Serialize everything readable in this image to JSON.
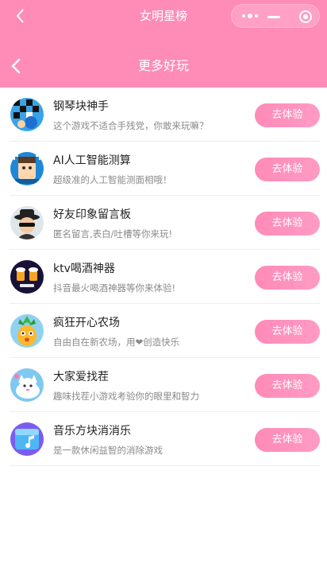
{
  "topbar": {
    "title": "女明星榜"
  },
  "page": {
    "title": "更多好玩"
  },
  "colors": {
    "primary": "#ff8bb7",
    "button": "#ff8ab8"
  },
  "games": [
    {
      "name": "钢琴块神手",
      "desc": "这个游戏不适合手残党，你敢来玩嘛？",
      "button": "去体验",
      "icon": "piano-tiles-icon"
    },
    {
      "name": "AI人工智能测算",
      "desc": "超级准的人工智能测面相哦！",
      "button": "去体验",
      "icon": "ai-face-icon"
    },
    {
      "name": "好友印象留言板",
      "desc": "匿名留言,表白/吐槽等你来玩!",
      "button": "去体验",
      "icon": "spy-icon"
    },
    {
      "name": "ktv喝酒神器",
      "desc": "抖音最火喝酒神器等你来体验!",
      "button": "去体验",
      "icon": "beer-icon"
    },
    {
      "name": "疯狂开心农场",
      "desc": "自由自在新农场，用❤创造快乐",
      "button": "去体验",
      "icon": "pineapple-icon"
    },
    {
      "name": "大家爱找茬",
      "desc": "趣味找茬小游戏考验你的眼里和智力",
      "button": "去体验",
      "icon": "cat-icon"
    },
    {
      "name": "音乐方块消消乐",
      "desc": "是一款休闲益智的消除游戏",
      "button": "去体验",
      "icon": "music-cube-icon"
    }
  ]
}
